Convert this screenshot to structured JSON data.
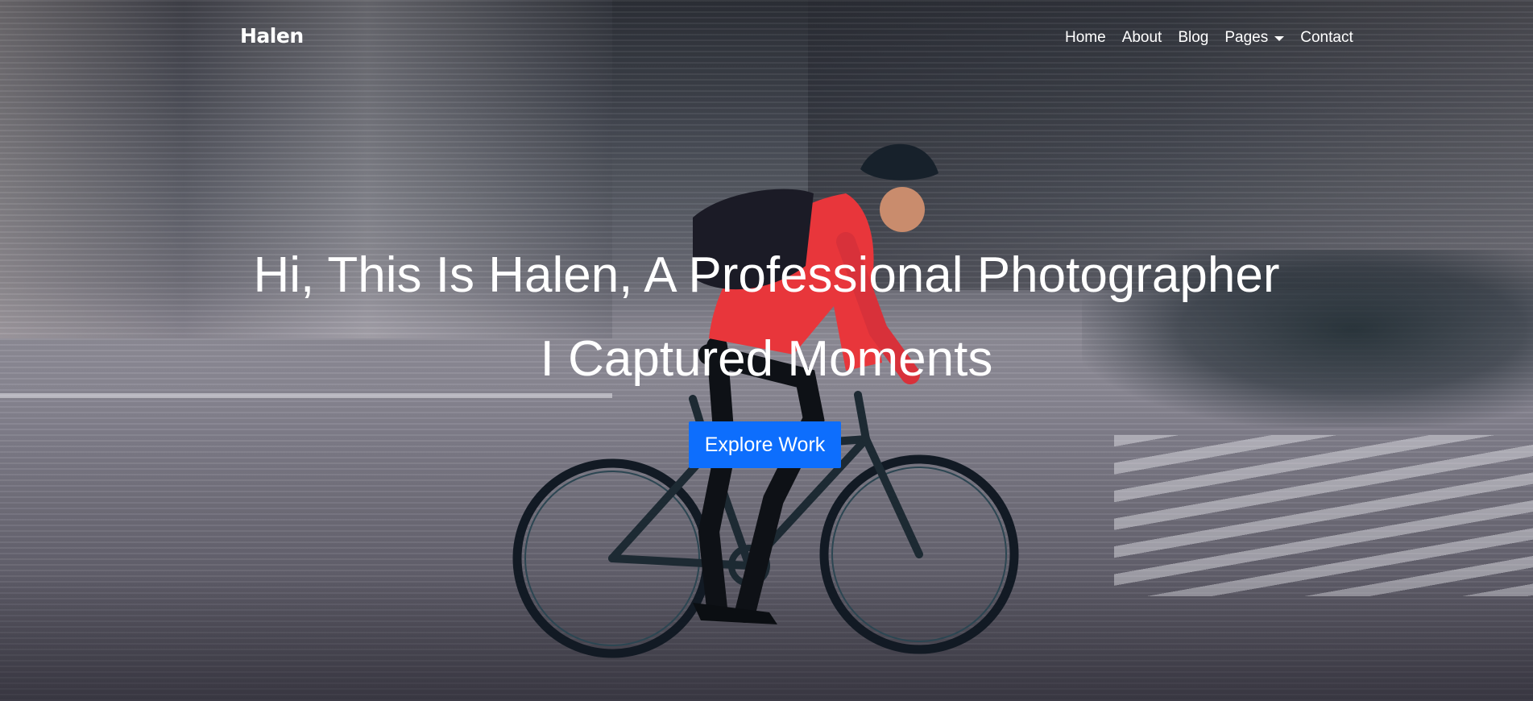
{
  "brand": {
    "name": "Halen"
  },
  "nav": {
    "items": [
      {
        "label": "Home"
      },
      {
        "label": "About"
      },
      {
        "label": "Blog"
      },
      {
        "label": "Pages"
      },
      {
        "label": "Contact"
      }
    ]
  },
  "hero": {
    "headline": "Hi, This Is Halen, A Professional Photographer",
    "subline": "I Captured Moments",
    "cta_label": "Explore Work"
  },
  "colors": {
    "accent": "#0d6efd",
    "text": "#ffffff"
  }
}
